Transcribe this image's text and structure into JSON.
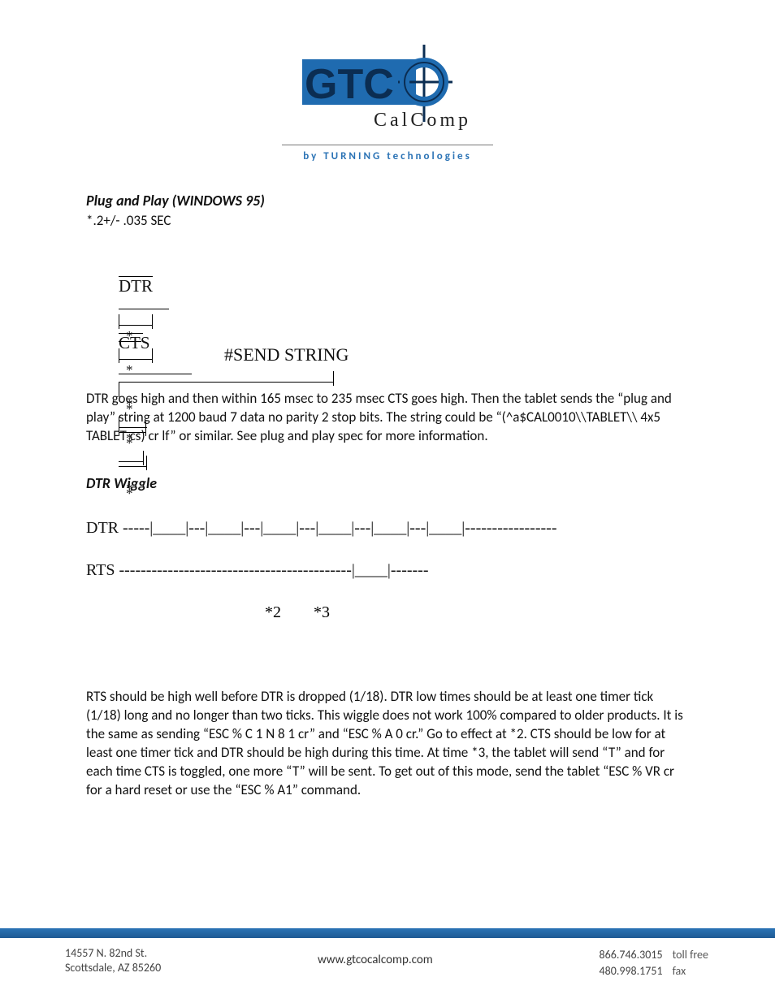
{
  "logo": {
    "text_main": "GTCO",
    "text_sub": "C a l C o m p",
    "tagline": "by TURNING technologies"
  },
  "section1": {
    "heading": "Plug and Play (WINDOWS 95)",
    "timing": "*.2+/- .035 SEC",
    "sig_dtr": "DTR",
    "sig_cts": "CTS",
    "send_string": "#SEND STRING",
    "paragraph": "DTR goes high and then within 165 msec to 235 msec CTS goes high.  Then the tablet sends the “plug and play” string at 1200 baud 7 data no parity 2 stop bits.  The string could be “(^a$CAL0010\\\\TABLET\\\\ 4x5 TABLET cs) cr lf” or similar.  See plug and play spec for more information."
  },
  "section2": {
    "heading": "DTR Wiggle",
    "dtr_line": "DTR -----|____|---|____|---|____|---|____|---|____|---|____|-----------------",
    "rts_line": "RTS -------------------------------------------|____|-------",
    "marks": "*2        *3",
    "paragraph": "RTS should be high well before DTR is dropped (1/18).  DTR low times should be at least one timer tick (1/18) long and no longer than two ticks.  This wiggle does not work 100% compared to older products.  It is the same as sending “ESC % C 1 N 8 1 cr” and “ESC % A 0 cr.”  Go to effect at *2.  CTS should be low for at least one timer tick and DTR should be high during this time.  At time *3, the tablet will send “T” and for each time CTS is toggled, one more “T” will be sent.  To get out of this mode, send the tablet “ESC % VR cr for a hard reset or use the “ESC % A1” command."
  },
  "footer": {
    "address_line1": "14557 N. 82nd St.",
    "address_line2": "Scottsdale, AZ 85260",
    "website": "www.gtcocalcomp.com",
    "phone_tollfree": "866.746.3015",
    "phone_tollfree_label": "toll free",
    "phone_fax": "480.998.1751",
    "phone_fax_label": "fax"
  }
}
